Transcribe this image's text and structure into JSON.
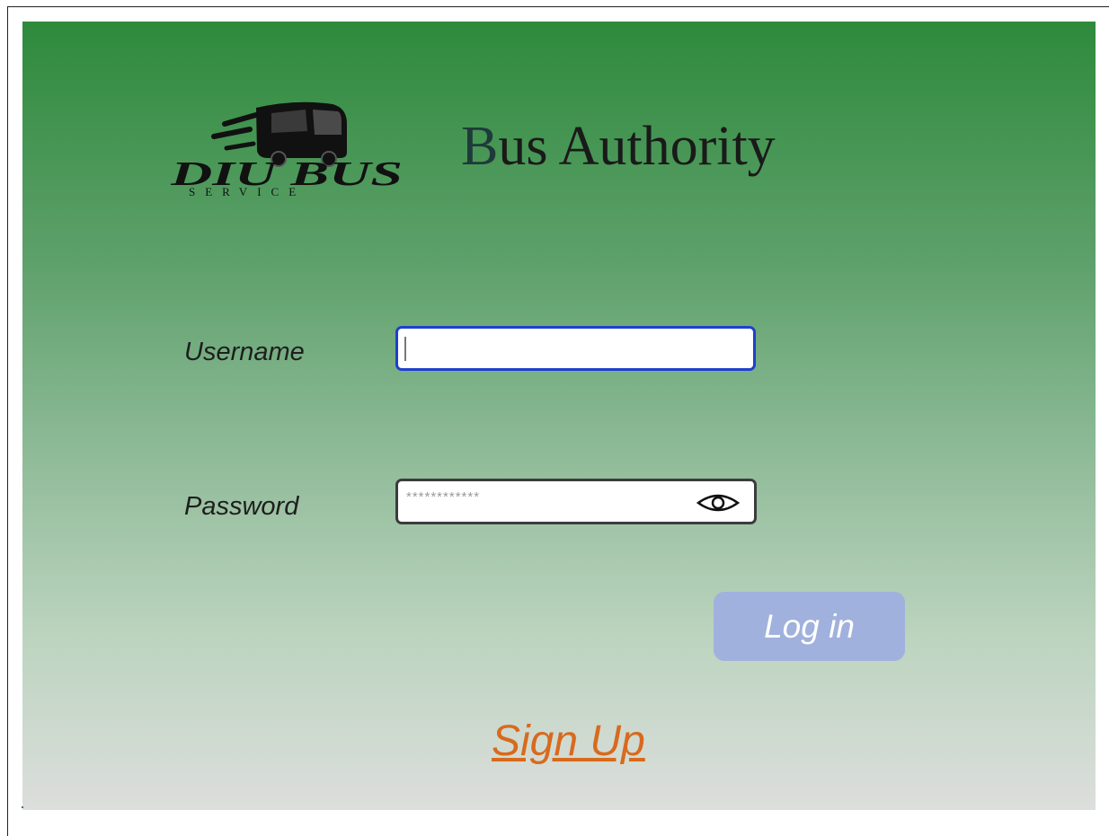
{
  "brand": {
    "logo_text": "DIU BUS",
    "logo_subtext": "SERVICE",
    "title_first": "B",
    "title_rest": "us Authority"
  },
  "form": {
    "username_label": "Username",
    "username_value": "",
    "password_label": "Password",
    "password_mask": "************",
    "show_password_icon": "eye-icon",
    "login_label": "Log in"
  },
  "signup": {
    "label": "Sign Up"
  },
  "colors": {
    "header_green": "#2e8a3c",
    "focus_border": "#1f3fd0",
    "login_button": "#a1b1dd",
    "signup_link": "#d86a1d"
  }
}
